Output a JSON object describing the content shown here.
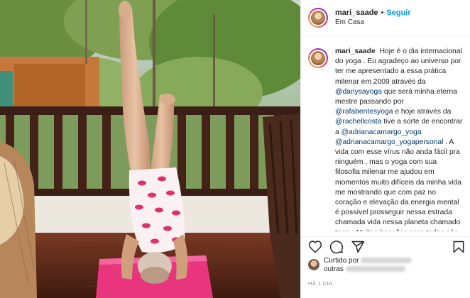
{
  "post": {
    "username": "mari_saade",
    "follow_label": "Seguir",
    "separator": "•",
    "location": "Em Casa",
    "photo_alt": "",
    "caption": {
      "seg1": "Hoje é o dia internacional do yoga . Eu agradeço ao universo por ter me apresentado a essa prática milenar em 2009 através da ",
      "m1": "@danysayoga",
      "seg2": " que será minha eterna mestre passando por ",
      "m2": "@rafabentesyoga",
      "seg3": " e hoje através da ",
      "m3": "@rachellcosta",
      "seg4": " tive a sorte de encontrar a ",
      "m4": "@adrianacamargo_yoga",
      "seg5": " ",
      "m5": "@adrianacamargo_yogapersonal",
      "seg6": " . A vida com esse vírus não anda fácil pra ninguém . mas o yoga com sua filosofia milenar me ajudou em momentos muito difíceis da minha vida me mostrando que com paz no coração e elevação da energia mental é possível prosseguir nessa estrada chamada vida nessa planeta chamado terra . Muitas benções para todos nós"
    },
    "likes": {
      "prefix": "Curtido por",
      "and_others": "outras"
    },
    "time": "Há 1 dia"
  },
  "icons": {
    "like": "heart-icon",
    "comment": "comment-icon",
    "share": "paper-plane-icon",
    "save": "bookmark-icon"
  },
  "colors": {
    "link": "#0095f6",
    "mention": "#00376b",
    "secondary": "#8e8e8e"
  }
}
